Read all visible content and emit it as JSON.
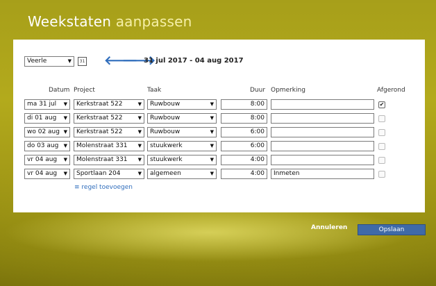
{
  "title": {
    "main": "Weekstaten",
    "accent": "aanpassen"
  },
  "filter": {
    "person": "Veerle",
    "calendar_icon": "calendar-icon",
    "prev_icon": "arrow-left-icon",
    "next_icon": "arrow-right-icon",
    "date_range": "31 jul 2017 - 04 aug 2017"
  },
  "columns": {
    "date": "Datum",
    "project": "Project",
    "task": "Taak",
    "duration": "Duur",
    "remark": "Opmerking",
    "done": "Afgerond"
  },
  "rows": [
    {
      "date": "ma 31 jul",
      "project": "Kerkstraat 522",
      "task": "Ruwbouw",
      "duration": "8:00",
      "remark": "",
      "done": true
    },
    {
      "date": "di 01 aug",
      "project": "Kerkstraat 522",
      "task": "Ruwbouw",
      "duration": "8:00",
      "remark": "",
      "done": false
    },
    {
      "date": "wo 02 aug",
      "project": "Kerkstraat 522",
      "task": "Ruwbouw",
      "duration": "6:00",
      "remark": "",
      "done": false
    },
    {
      "date": "do 03 aug",
      "project": "Molenstraat 331",
      "task": "stuukwerk",
      "duration": "6:00",
      "remark": "",
      "done": false
    },
    {
      "date": "vr 04 aug",
      "project": "Molenstraat 331",
      "task": "stuukwerk",
      "duration": "4:00",
      "remark": "",
      "done": false
    },
    {
      "date": "vr 04 aug",
      "project": "Sportlaan 204",
      "task": "algemeen",
      "duration": "4:00",
      "remark": "Inmeten",
      "done": false
    }
  ],
  "add_row": "≡ regel toevoegen",
  "actions": {
    "cancel": "Annuleren",
    "save": "Opslaan"
  },
  "colors": {
    "accent": "#2f6dbc",
    "save_button": "#3f6aa8",
    "background": "#a79f1a"
  }
}
